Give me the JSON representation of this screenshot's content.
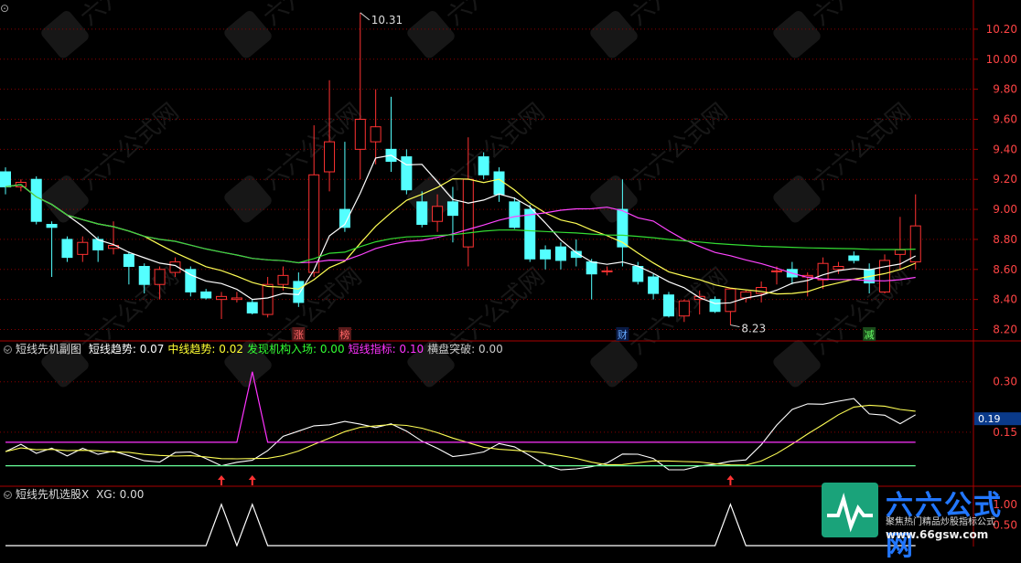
{
  "top_fragment": "⊙",
  "price_panel": {
    "y_ticks": [
      "10.20",
      "10.00",
      "9.80",
      "9.60",
      "9.40",
      "9.20",
      "9.00",
      "8.80",
      "8.60",
      "8.40",
      "8.20"
    ],
    "high_label": "10.31",
    "low_label": "8.23",
    "markers": [
      {
        "text": "涨",
        "color": "#ff6666",
        "bg": "#5a1a1a"
      },
      {
        "text": "榜",
        "color": "#ff6666",
        "bg": "#5a1a1a"
      },
      {
        "text": "财",
        "color": "#66aaff",
        "bg": "#0a1a44"
      },
      {
        "text": "减",
        "color": "#66ff66",
        "bg": "#1a4a1a"
      }
    ]
  },
  "indicator_panel": {
    "title": "短线先机副图",
    "items": [
      {
        "label": "短线趋势:",
        "value": "0.07",
        "color": "#ffffff"
      },
      {
        "label": "中线趋势:",
        "value": "0.02",
        "color": "#ffff33"
      },
      {
        "label": "发现机构入场:",
        "value": "0.00",
        "color": "#33ff33"
      },
      {
        "label": "短线指标:",
        "value": "0.10",
        "color": "#ff33ff"
      },
      {
        "label": "横盘突破:",
        "value": "0.00",
        "color": "#cccccc"
      }
    ],
    "y_ticks": [
      "0.30",
      "0.15"
    ],
    "current_value": "0.19"
  },
  "xg_panel": {
    "title": "短线先机选股X",
    "label": "XG:",
    "value": "0.00",
    "y_ticks": [
      "1.00",
      "0.50"
    ]
  },
  "watermark": {
    "brand": "六六公式网",
    "slogan": "聚焦热门精品炒股指标公式",
    "url": "www.66gsw.com"
  },
  "chart_data": {
    "type": "candlestick",
    "ylim": [
      8.13,
      10.37
    ],
    "candles": [
      [
        9.25,
        9.28,
        9.1,
        9.15
      ],
      [
        9.15,
        9.2,
        9.12,
        9.18
      ],
      [
        9.2,
        9.22,
        8.9,
        8.92
      ],
      [
        8.9,
        8.92,
        8.55,
        8.88
      ],
      [
        8.8,
        8.82,
        8.65,
        8.68
      ],
      [
        8.7,
        8.82,
        8.65,
        8.78
      ],
      [
        8.8,
        8.82,
        8.65,
        8.73
      ],
      [
        8.74,
        8.92,
        8.7,
        8.76
      ],
      [
        8.7,
        8.72,
        8.5,
        8.62
      ],
      [
        8.62,
        8.64,
        8.44,
        8.5
      ],
      [
        8.5,
        8.62,
        8.4,
        8.6
      ],
      [
        8.58,
        8.68,
        8.55,
        8.65
      ],
      [
        8.6,
        8.62,
        8.42,
        8.45
      ],
      [
        8.45,
        8.47,
        8.4,
        8.41
      ],
      [
        8.4,
        8.45,
        8.27,
        8.42
      ],
      [
        8.4,
        8.45,
        8.38,
        8.41
      ],
      [
        8.38,
        8.4,
        8.3,
        8.31
      ],
      [
        8.3,
        8.55,
        8.28,
        8.5
      ],
      [
        8.5,
        8.62,
        8.46,
        8.56
      ],
      [
        8.52,
        8.58,
        8.35,
        8.38
      ],
      [
        8.58,
        9.56,
        8.55,
        9.23
      ],
      [
        9.25,
        9.86,
        9.12,
        9.45
      ],
      [
        9.0,
        9.45,
        8.85,
        8.88
      ],
      [
        9.4,
        10.31,
        9.2,
        9.6
      ],
      [
        9.45,
        9.8,
        9.3,
        9.55
      ],
      [
        9.4,
        9.75,
        9.25,
        9.32
      ],
      [
        9.35,
        9.4,
        9.1,
        9.13
      ],
      [
        9.05,
        9.12,
        8.88,
        8.9
      ],
      [
        8.92,
        9.1,
        8.85,
        9.02
      ],
      [
        9.05,
        9.15,
        8.78,
        8.96
      ],
      [
        8.75,
        9.48,
        8.62,
        9.2
      ],
      [
        9.35,
        9.38,
        9.2,
        9.23
      ],
      [
        9.25,
        9.28,
        9.05,
        9.1
      ],
      [
        9.05,
        9.08,
        8.87,
        8.88
      ],
      [
        9.0,
        9.03,
        8.65,
        8.67
      ],
      [
        8.73,
        8.76,
        8.6,
        8.67
      ],
      [
        8.75,
        8.78,
        8.6,
        8.66
      ],
      [
        8.72,
        8.8,
        8.62,
        8.68
      ],
      [
        8.65,
        8.67,
        8.4,
        8.57
      ],
      [
        8.59,
        8.62,
        8.56,
        8.59
      ],
      [
        9.0,
        9.2,
        8.62,
        8.75
      ],
      [
        8.62,
        8.65,
        8.5,
        8.52
      ],
      [
        8.55,
        8.57,
        8.4,
        8.44
      ],
      [
        8.43,
        8.45,
        8.28,
        8.29
      ],
      [
        8.29,
        8.4,
        8.25,
        8.39
      ],
      [
        8.4,
        8.46,
        8.3,
        8.42
      ],
      [
        8.4,
        8.42,
        8.31,
        8.32
      ],
      [
        8.32,
        8.47,
        8.23,
        8.47
      ],
      [
        8.41,
        8.46,
        8.38,
        8.45
      ],
      [
        8.44,
        8.52,
        8.38,
        8.48
      ],
      [
        8.59,
        8.62,
        8.5,
        8.59
      ],
      [
        8.6,
        8.65,
        8.5,
        8.55
      ],
      [
        8.55,
        8.58,
        8.42,
        8.56
      ],
      [
        8.53,
        8.68,
        8.47,
        8.64
      ],
      [
        8.6,
        8.65,
        8.57,
        8.62
      ],
      [
        8.69,
        8.72,
        8.64,
        8.66
      ],
      [
        8.6,
        8.64,
        8.44,
        8.51
      ],
      [
        8.45,
        8.7,
        8.44,
        8.66
      ],
      [
        8.7,
        8.95,
        8.6,
        8.73
      ],
      [
        8.65,
        9.1,
        8.6,
        8.89
      ]
    ],
    "annotations": [
      {
        "text": "10.31",
        "value": 10.31
      },
      {
        "text": "8.23",
        "value": 8.23
      }
    ]
  }
}
